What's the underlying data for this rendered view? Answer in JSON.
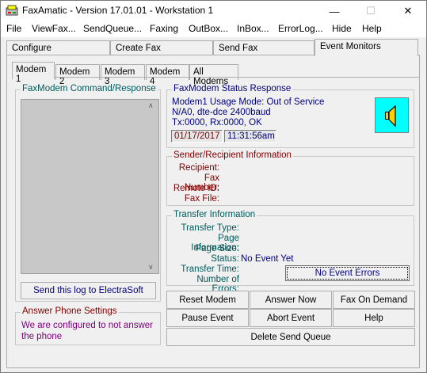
{
  "window": {
    "title": "FaxAmatic - Version 17.01.01 - Workstation 1",
    "minimize": "—",
    "maximize": "☐",
    "close": "✕"
  },
  "menu": [
    "File",
    "ViewFax...",
    "SendQueue...",
    "Faxing",
    "OutBox...",
    "InBox...",
    "ErrorLog...",
    "Hide",
    "Help"
  ],
  "tabs": {
    "top": [
      "Configure",
      "Create Fax",
      "Send Fax",
      "Event Monitors"
    ],
    "active_top": "Event Monitors",
    "sub": [
      "Modem 1",
      "Modem 2",
      "Modem 3",
      "Modem 4",
      "All Modems"
    ],
    "active_sub": "Modem 1"
  },
  "log": {
    "title": "FaxModem Command/Response",
    "send_button": "Send this log to ElectraSoft"
  },
  "answer": {
    "title": "Answer Phone Settings",
    "text": "We are configured to not answer the phone"
  },
  "status": {
    "title": "FaxModem Status Response",
    "line1": "Modem1 Usage Mode: Out of Service",
    "line2": "N/A0, dte-dce 2400baud",
    "line3": "Tx:0000, Rx:0000, OK",
    "date": "01/17/2017",
    "time": "11:31:56am"
  },
  "sender": {
    "title": "Sender/Recipient Information",
    "labels": [
      "Recipient:",
      "Fax Number:",
      "Remote ID:",
      "Fax File:"
    ]
  },
  "transfer": {
    "title": "Transfer Information",
    "labels": [
      "Transfer Type:",
      "Page Information:",
      "Page Size:",
      "Status:",
      "Transfer Time:",
      "Number of Errors:"
    ],
    "status_value": "No Event Yet",
    "errors_button": "No Event Errors"
  },
  "buttons": {
    "reset_modem": "Reset Modem",
    "answer_now": "Answer Now",
    "fax_on_demand": "Fax On Demand",
    "pause_event": "Pause Event",
    "abort_event": "Abort Event",
    "help": "Help",
    "delete_send_queue": "Delete Send Queue"
  }
}
